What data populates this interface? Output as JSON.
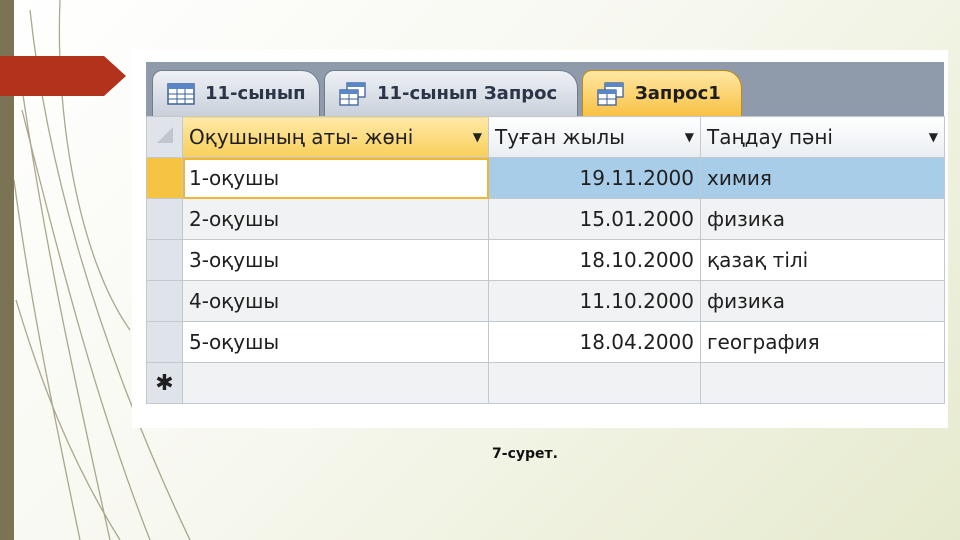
{
  "tabs": [
    {
      "label": "11-сынып",
      "icon": "table-icon",
      "active": false
    },
    {
      "label": "11-сынып Запрос",
      "icon": "query-icon",
      "active": false
    },
    {
      "label": "Запрос1",
      "icon": "query-icon",
      "active": true
    }
  ],
  "grid": {
    "columns": [
      "Оқушының аты- жөні",
      "Туған жылы",
      "Таңдау  пәні"
    ],
    "rows": [
      [
        "1-оқушы",
        "19.11.2000",
        "химия"
      ],
      [
        "2-оқушы",
        "15.01.2000",
        "физика"
      ],
      [
        "3-оқушы",
        "18.10.2000",
        "қазақ тілі"
      ],
      [
        "4-оқушы",
        "11.10.2000",
        "физика"
      ],
      [
        "5-оқушы",
        "18.04.2000",
        "география"
      ]
    ],
    "new_row_marker": "✱"
  },
  "caption": "7-сурет.",
  "colors": {
    "active_tab": "#f8c245",
    "selected_row": "#a8cde9",
    "arrow": "#b3321c",
    "left_bar": "#7b7454"
  }
}
